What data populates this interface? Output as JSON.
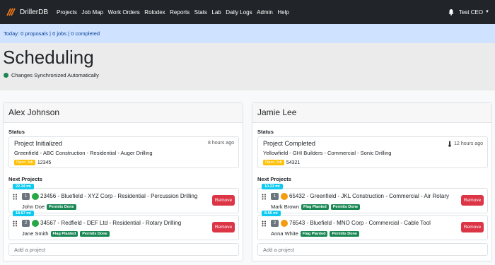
{
  "navbar": {
    "brand": "DrillerDB",
    "links": [
      "Projects",
      "Job Map",
      "Work Orders",
      "Rolodex",
      "Reports",
      "Stats",
      "Lab",
      "Daily Logs",
      "Admin",
      "Help"
    ],
    "user": "Test CEO"
  },
  "statusbar": {
    "text": "Today: 0 proposals | 0 jobs | 0 completed"
  },
  "page": {
    "title": "Scheduling",
    "sync_text": "Changes Synchronized Automatically"
  },
  "colors": {
    "navbar": "#212529",
    "statusbar": "#cfe2ff",
    "success": "#198754",
    "danger": "#dc3545",
    "info": "#0dcaf0",
    "warning": "#ffc107"
  },
  "crews": [
    {
      "name": "Alex Johnson",
      "status_label": "Status",
      "status": {
        "title": "Project Initialized",
        "time": "8 hours ago",
        "subtitle": "Greenfield - ABC Construction - Residential - Auger Drilling",
        "badge": "Open Job",
        "job": "12345"
      },
      "next_label": "Next Projects",
      "projects": [
        {
          "miles": "22.34 mi",
          "num": "1",
          "dot": "green",
          "title": "23456 - Bluefield - XYZ Corp - Residential - Percussion Drilling",
          "person": "John Doe",
          "tags": [
            "Permits Done"
          ],
          "remove": "Remove"
        },
        {
          "miles": "18.67 mi",
          "num": "2",
          "dot": "green",
          "title": "34567 - Redfield - DEF Ltd - Residential - Rotary Drilling",
          "person": "Jane Smith",
          "tags": [
            "Flag Planted",
            "Permits Done"
          ],
          "remove": "Remove"
        }
      ],
      "add_placeholder": "Add a project"
    },
    {
      "name": "Jamie Lee",
      "status_label": "Status",
      "status": {
        "title": "Project Completed",
        "time": "12 hours ago",
        "subtitle": "Yellowfield - GHI Builders - Commercial - Sonic Drilling",
        "badge": "Open Job",
        "job": "54321"
      },
      "next_label": "Next Projects",
      "projects": [
        {
          "miles": "10.23 mi",
          "num": "1",
          "dot": "orange",
          "title": "65432 - Greenfield - JKL Construction - Commercial - Air Rotary",
          "person": "Mark Brown",
          "tags": [
            "Flag Planted",
            "Permits Done"
          ],
          "remove": "Remove"
        },
        {
          "miles": "8.56 mi",
          "num": "2",
          "dot": "orange",
          "title": "76543 - Bluefield - MNO Corp - Commercial - Cable Tool",
          "person": "Anna White",
          "tags": [
            "Flag Planted",
            "Permits Done"
          ],
          "remove": "Remove"
        }
      ],
      "add_placeholder": "Add a project"
    }
  ]
}
